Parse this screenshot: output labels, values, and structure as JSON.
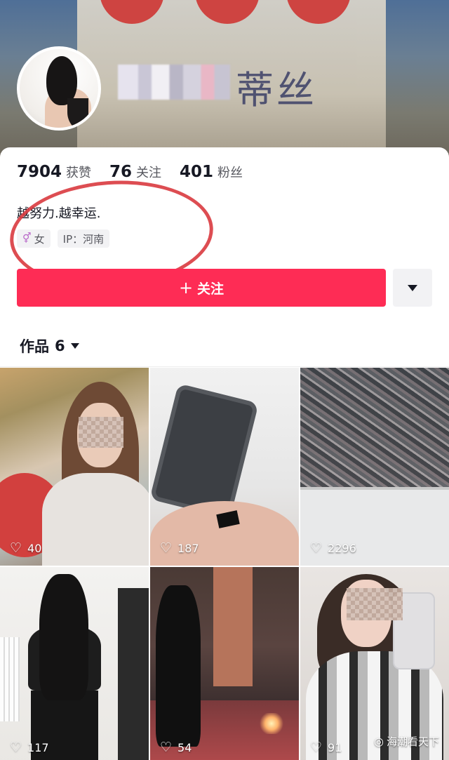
{
  "profile": {
    "name": "蒂丝",
    "stats": [
      {
        "value": "7904",
        "label": "获赞"
      },
      {
        "value": "76",
        "label": "关注"
      },
      {
        "value": "401",
        "label": "粉丝"
      }
    ],
    "bio": "越努力.越幸运.",
    "tags": {
      "gender_icon": "⚥",
      "gender": "女",
      "ip": "IP：河南"
    }
  },
  "actions": {
    "follow_plus": "+",
    "follow_label": "关注",
    "more_icon": "chevron-down-icon"
  },
  "works_tab": {
    "label": "作品",
    "count": "6"
  },
  "grid": [
    {
      "likes": "40"
    },
    {
      "likes": "187"
    },
    {
      "likes": "2296"
    },
    {
      "likes": "117"
    },
    {
      "likes": "54"
    },
    {
      "likes": "91"
    }
  ],
  "watermark": {
    "icon": "weibo-icon",
    "text": "海潮看天下"
  },
  "colors": {
    "follow_button": "#fe2c55",
    "annotation_circle": "#d93a3f"
  }
}
